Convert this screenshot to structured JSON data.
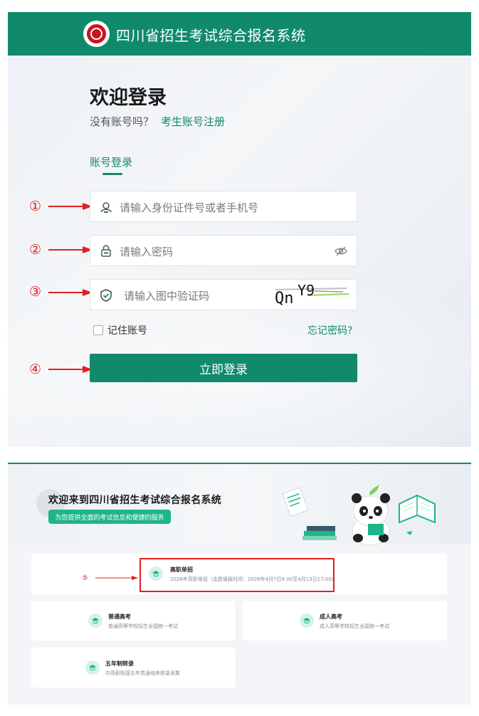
{
  "login": {
    "system_title": "四川省招生考试综合报名系统",
    "welcome": "欢迎登录",
    "no_account": "没有账号吗？",
    "register_link": "考生账号注册",
    "tab_account": "账号登录",
    "id_placeholder": "请输入身份证件号或者手机号",
    "password_placeholder": "请输入密码",
    "captcha_placeholder": "请输入图中验证码",
    "captcha_text": "QnY9",
    "remember_label": "记住账号",
    "forgot_label": "忘记密码?",
    "login_button": "立即登录",
    "markers": [
      "①",
      "②",
      "③",
      "④"
    ],
    "colors": {
      "brand": "#108a6b",
      "marker": "#e02020"
    },
    "icons": [
      "logo-seal",
      "user-icon",
      "lock-icon",
      "eye-off-icon",
      "shield-check-icon"
    ]
  },
  "portal": {
    "hero_title": "欢迎来到四川省招生考试综合报名系统",
    "hero_subtitle": "为您提供全面的考试信息和便捷的服务",
    "marker": "⑤",
    "cards": [
      {
        "name": "高职单招",
        "desc": "2026年高职单招（志愿填报时间：2026年4月7日9:00至4月13日17:00）"
      },
      {
        "name": "普通高考",
        "desc": "普通高等学校招生全国统一考试"
      },
      {
        "name": "成人高考",
        "desc": "成人高等学校招生全国统一考试"
      },
      {
        "name": "五年制转录",
        "desc": "中高职衔接五年贯通培养转录采集"
      }
    ],
    "icons": [
      "graduation-cap-icon",
      "panda-illustration",
      "book-illustration"
    ]
  }
}
